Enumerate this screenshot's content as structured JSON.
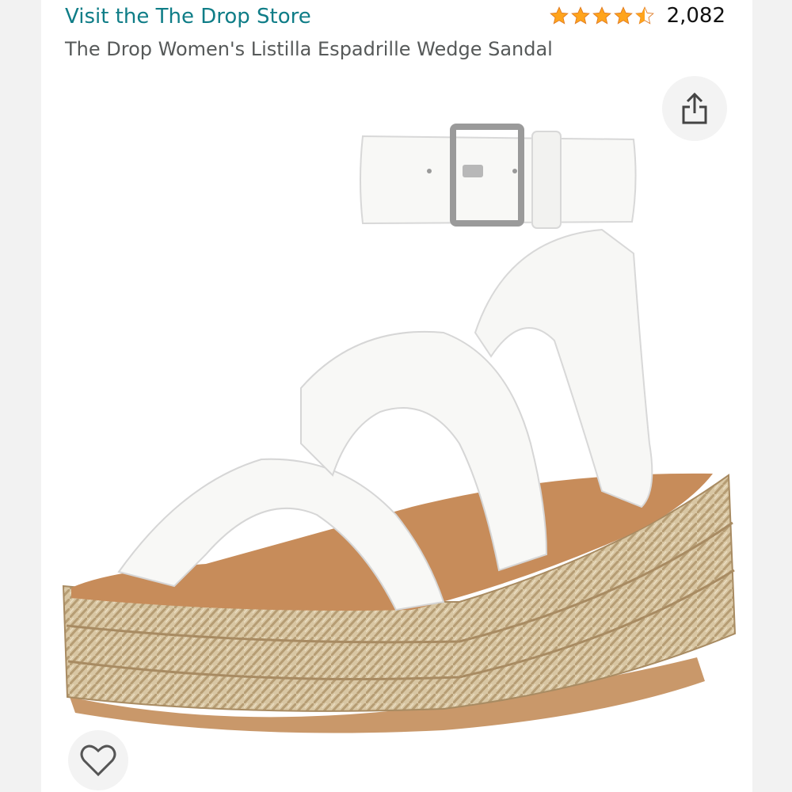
{
  "header": {
    "store_link": "Visit the The Drop Store",
    "rating_value": 4.5,
    "rating_count": "2,082",
    "product_title": "The Drop Women's Listilla Espadrille Wedge Sandal"
  },
  "colors": {
    "link": "#0f7d87",
    "star": "#ffa41c",
    "title_text": "#565959",
    "background": "#f2f2f2"
  },
  "image": {
    "icons": [
      "share-icon",
      "heart-icon"
    ]
  }
}
